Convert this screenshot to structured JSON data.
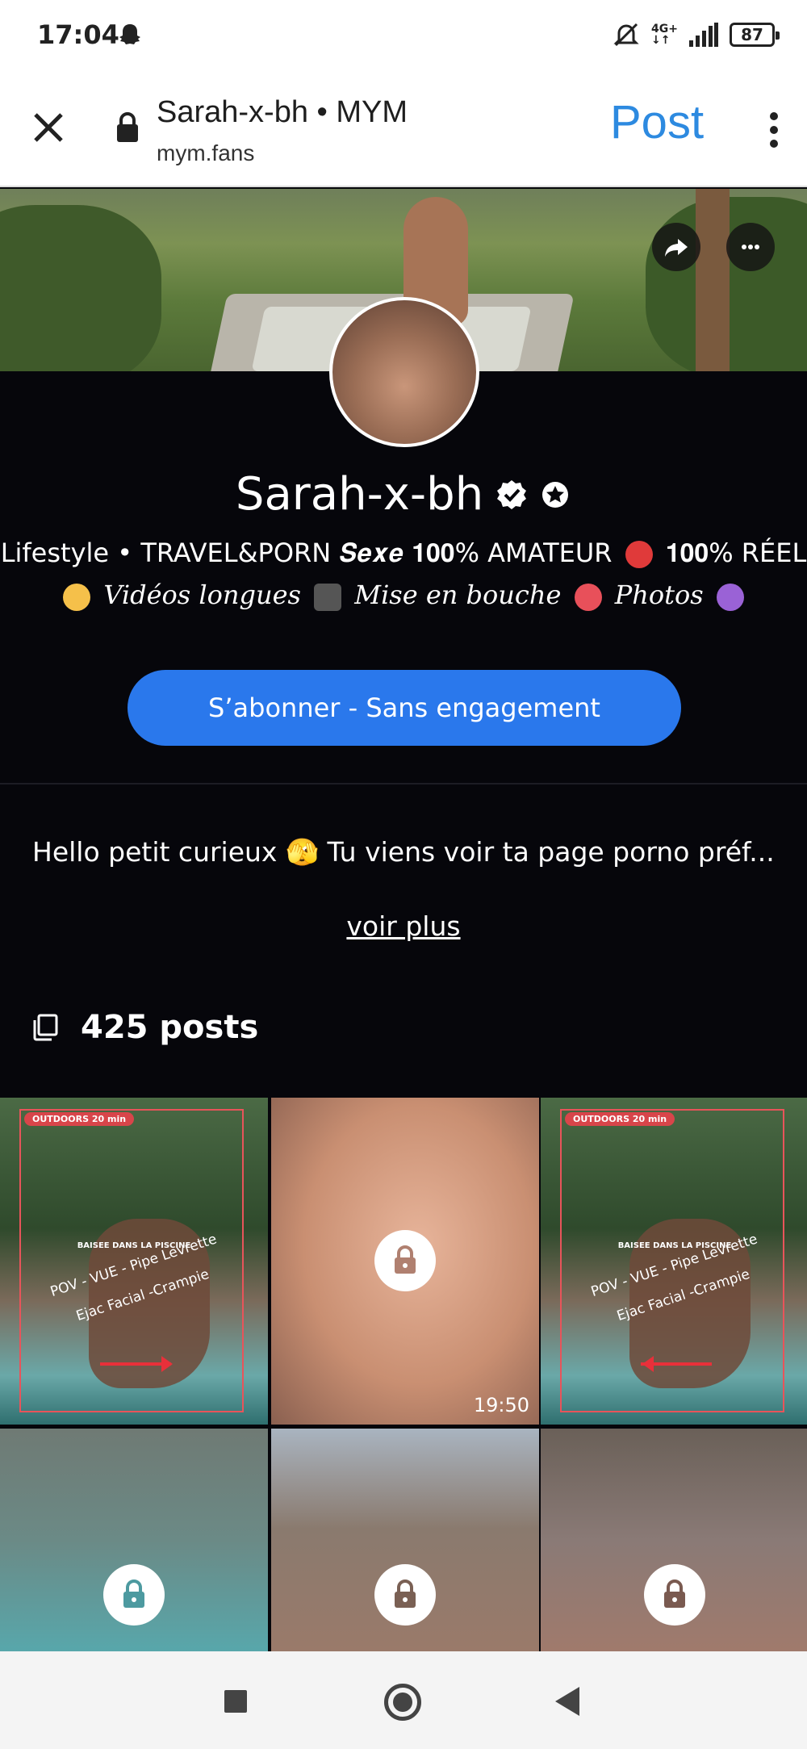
{
  "status_bar": {
    "time": "17:04",
    "network": "4G+",
    "battery": "87",
    "icons": [
      "snapchat-ghost-icon",
      "silent-icon",
      "signal-icon",
      "battery-icon"
    ]
  },
  "browser": {
    "title": "Sarah-x-bh • MYM",
    "url": "mym.fans",
    "action_label": "Post",
    "action_color": "#2d8ae0"
  },
  "profile": {
    "name": "Sarah-x-bh",
    "bio_line1": "Lifestyle • TRAVEL&PORN 𝑺𝒆𝒙𝒆 𝟏𝟎𝟎% AMATEUR",
    "bio_line1_tail": "𝟏𝟎𝟎% RÉEL",
    "bio_line2_a": "Vidéos longues",
    "bio_line2_b": "Mise en bouche",
    "bio_line2_c": "Photos",
    "subscribe_label": "S’abonner - Sans engagement",
    "accent_color": "#2a78ec",
    "description": "Hello petit curieux 🫣 Tu viens voir ta page porno préf...",
    "more_label": "voir plus",
    "posts_count": "425 posts"
  },
  "grid": {
    "tile_caption_badge": "OUTDOORS 20 min",
    "tile_caption_title": "BAISEE DANS LA PISCINE",
    "tile_caption_line1": "POV - VUE - Pipe  Levrette",
    "tile_caption_line2": "Ejac Facial -Crampie",
    "video_duration": "19:50"
  }
}
